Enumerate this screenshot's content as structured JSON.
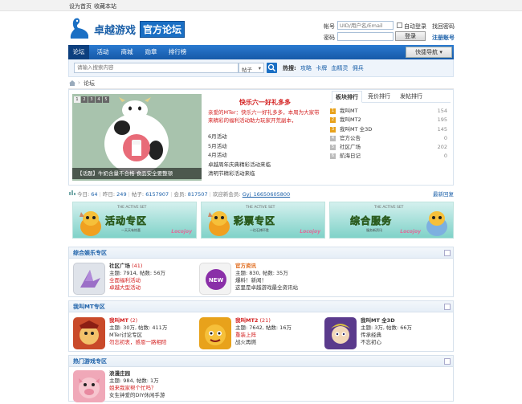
{
  "topbar": {
    "set_home": "设为首页",
    "bookmark": "收藏本站"
  },
  "logo": {
    "text": "卓越游戏",
    "badge": "官方论坛"
  },
  "login": {
    "account_label": "帐号",
    "account_placeholder": "UID/用户名/Email",
    "auto_login": "自动登录",
    "find_password": "找回密码",
    "password_label": "密码",
    "login_button": "登录",
    "register": "注册账号"
  },
  "nav": {
    "items": [
      "论坛",
      "活动",
      "商城",
      "勋章",
      "排行榜"
    ],
    "active_index": 0,
    "quick_nav": "快捷导航"
  },
  "search": {
    "placeholder": "请输入搜索内容",
    "scope": "帖子",
    "hot_label": "热搜:",
    "hot_terms": [
      "攻略",
      "卡牌",
      "血精灵",
      "佣兵"
    ]
  },
  "breadcrumb": {
    "current": "论坛"
  },
  "slideshow": {
    "caption": "【话题】牛奶含量不合格 食品安全要整顿",
    "pages": [
      "1",
      "2",
      "3",
      "4",
      "5"
    ],
    "active_page": 0
  },
  "news": {
    "title": "快乐六一好礼多多",
    "desc": "亲爱的MTer：快乐六一好礼多多，本周为大家带来精彩的福利活动助力玩家开荒副本，",
    "items": [
      "6月活动",
      "5月活动",
      "4月活动",
      "卓越周年庆典精彩活动来临",
      "清明节精彩活动来临"
    ]
  },
  "rank_tabs": {
    "tabs": [
      "板块排行",
      "竞价排行",
      "发帖排行"
    ],
    "active_index": 0
  },
  "rank": [
    {
      "no": "1",
      "name": "我叫MT",
      "count": "154"
    },
    {
      "no": "2",
      "name": "我叫MT2",
      "count": "195"
    },
    {
      "no": "3",
      "name": "我叫MT 全3D",
      "count": "145"
    },
    {
      "no": "4",
      "name": "官方公告",
      "count": "0"
    },
    {
      "no": "5",
      "name": "社区广场",
      "count": "202"
    },
    {
      "no": "6",
      "name": "航海日记",
      "count": "0"
    }
  ],
  "stats": {
    "today_label": "今日:",
    "today": "64",
    "yesterday_label": "昨日:",
    "yesterday": "249",
    "posts_label": "帖子:",
    "posts": "6157907",
    "members_label": "会员:",
    "members": "817507",
    "welcome_label": "欢迎新会员:",
    "new_member": "Gyj_16650605800",
    "latest_reply": "最新回复"
  },
  "banners": [
    {
      "top": "THE ACTIVE SET",
      "title": "活动专区",
      "sub": "一天天有惊喜",
      "logo": "Locojoy"
    },
    {
      "top": "THE ACTIVE SET",
      "title": "彩票专区",
      "sub": "一往石博不胜",
      "logo": "Locojoy"
    },
    {
      "top": "THE ACTIVE SET",
      "title": "综合服务",
      "sub": "服务新资讯",
      "logo": "Locojoy"
    }
  ],
  "sections": [
    {
      "title": "综合娱乐专区",
      "forums": [
        {
          "name": "社区广场",
          "count": "(41)",
          "stats": "主题: 7914, 帖数: 56万",
          "line1": "全面福利活动",
          "line2": "卓越大型活动"
        },
        {
          "name": "官方资讯",
          "count": "",
          "stats": "主题: 830, 帖数: 35万",
          "line1": "爆料！新闻！",
          "line2": "这里是卓越游戏最全资讯站"
        }
      ]
    },
    {
      "title": "我叫MT专区",
      "forums": [
        {
          "name": "我叫MT",
          "count": "(2)",
          "stats": "主题: 30万, 帖数: 411万",
          "line1": "MTer讨论专区",
          "line2": "勿忘初衷，感恩一路相陪"
        },
        {
          "name": "我叫MT2",
          "count": "(21)",
          "stats": "主题: 7642, 帖数: 16万",
          "line1": "重装上阵",
          "line2": "战火再燃"
        },
        {
          "name": "我叫MT 全3D",
          "count": "",
          "stats": "主题: 3万, 帖数: 66万",
          "line1": "传承经典",
          "line2": "不忘初心"
        }
      ]
    },
    {
      "title": "热门游戏专区",
      "forums": [
        {
          "name": "浪漫庄园",
          "count": "",
          "stats": "主题: 984, 帖数: 1万",
          "line1": "姐来我家帮个忙吗？",
          "line2": "女生钟爱的DIY休闲手游"
        }
      ]
    }
  ],
  "colors": {
    "brand_blue": "#1a6fc4",
    "nav_dark": "#0d3f7e",
    "accent_red": "#d31e1e"
  }
}
